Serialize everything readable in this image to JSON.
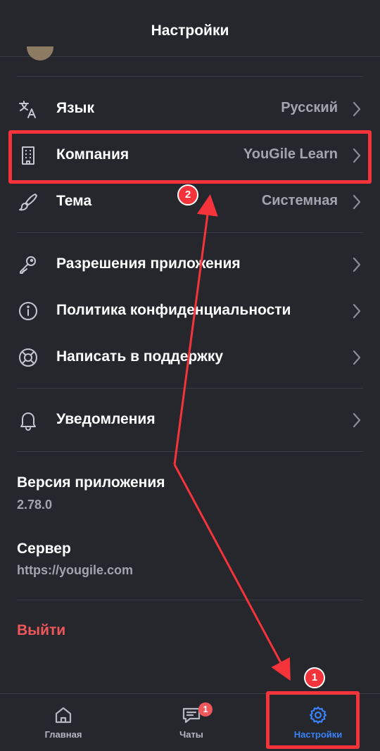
{
  "header": {
    "title": "Настройки"
  },
  "settings": {
    "group1": [
      {
        "label": "Язык",
        "value": "Русский",
        "icon": "translate-icon"
      },
      {
        "label": "Компания",
        "value": "YouGile Learn",
        "icon": "building-icon"
      },
      {
        "label": "Тема",
        "value": "Системная",
        "icon": "brush-icon"
      }
    ],
    "group2": [
      {
        "label": "Разрешения приложения",
        "icon": "key-icon"
      },
      {
        "label": "Политика конфиденциальности",
        "icon": "info-icon"
      },
      {
        "label": "Написать в поддержку",
        "icon": "lifebuoy-icon"
      }
    ],
    "group3": [
      {
        "label": "Уведомления",
        "icon": "bell-icon"
      }
    ]
  },
  "app_info": {
    "version_label": "Версия приложения",
    "version": "2.78.0",
    "server_label": "Сервер",
    "server": "https://yougile.com"
  },
  "logout_label": "Выйти",
  "tabbar": {
    "tabs": [
      {
        "label": "Главная",
        "icon": "home-icon"
      },
      {
        "label": "Чаты",
        "icon": "chat-icon",
        "badge": "1"
      },
      {
        "label": "Настройки",
        "icon": "gear-icon",
        "active": true
      }
    ]
  },
  "annotations": {
    "marker1": "1",
    "marker2": "2"
  },
  "colors": {
    "background": "#25272d",
    "accent": "#3a82f7",
    "danger": "#f0575a",
    "annotation": "#f4343a"
  }
}
